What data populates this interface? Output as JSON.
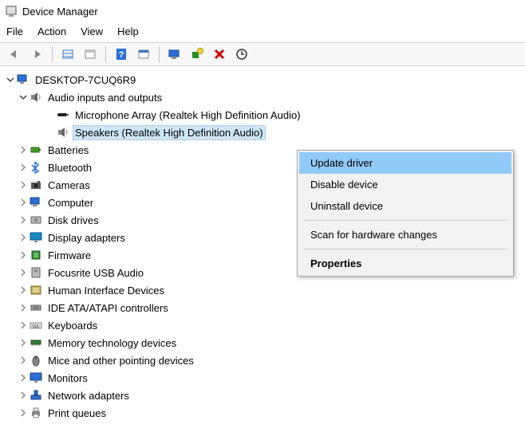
{
  "window": {
    "title": "Device Manager"
  },
  "menubar": {
    "items": [
      "File",
      "Action",
      "View",
      "Help"
    ]
  },
  "tree": {
    "root": "DESKTOP-7CUQ6R9",
    "categories": [
      {
        "label": "Audio inputs and outputs",
        "icon": "speaker-icon",
        "expanded": true,
        "children": [
          {
            "label": "Microphone Array (Realtek High Definition Audio)",
            "icon": "microphone-icon"
          },
          {
            "label": "Speakers (Realtek High Definition Audio)",
            "icon": "speaker-icon",
            "selected": true
          }
        ]
      },
      {
        "label": "Batteries",
        "icon": "battery-icon"
      },
      {
        "label": "Bluetooth",
        "icon": "bluetooth-icon"
      },
      {
        "label": "Cameras",
        "icon": "camera-icon"
      },
      {
        "label": "Computer",
        "icon": "computer-icon"
      },
      {
        "label": "Disk drives",
        "icon": "disk-icon"
      },
      {
        "label": "Display adapters",
        "icon": "display-icon"
      },
      {
        "label": "Firmware",
        "icon": "firmware-icon"
      },
      {
        "label": "Focusrite USB Audio",
        "icon": "usb-audio-icon"
      },
      {
        "label": "Human Interface Devices",
        "icon": "hid-icon"
      },
      {
        "label": "IDE ATA/ATAPI controllers",
        "icon": "ide-icon"
      },
      {
        "label": "Keyboards",
        "icon": "keyboard-icon"
      },
      {
        "label": "Memory technology devices",
        "icon": "memory-icon"
      },
      {
        "label": "Mice and other pointing devices",
        "icon": "mouse-icon"
      },
      {
        "label": "Monitors",
        "icon": "monitor-icon"
      },
      {
        "label": "Network adapters",
        "icon": "network-icon"
      },
      {
        "label": "Print queues",
        "icon": "printer-icon"
      }
    ]
  },
  "context_menu": {
    "items": [
      {
        "label": "Update driver",
        "hover": true
      },
      {
        "label": "Disable device"
      },
      {
        "label": "Uninstall device"
      },
      {
        "sep": true
      },
      {
        "label": "Scan for hardware changes"
      },
      {
        "sep": true
      },
      {
        "label": "Properties",
        "bold": true
      }
    ]
  }
}
